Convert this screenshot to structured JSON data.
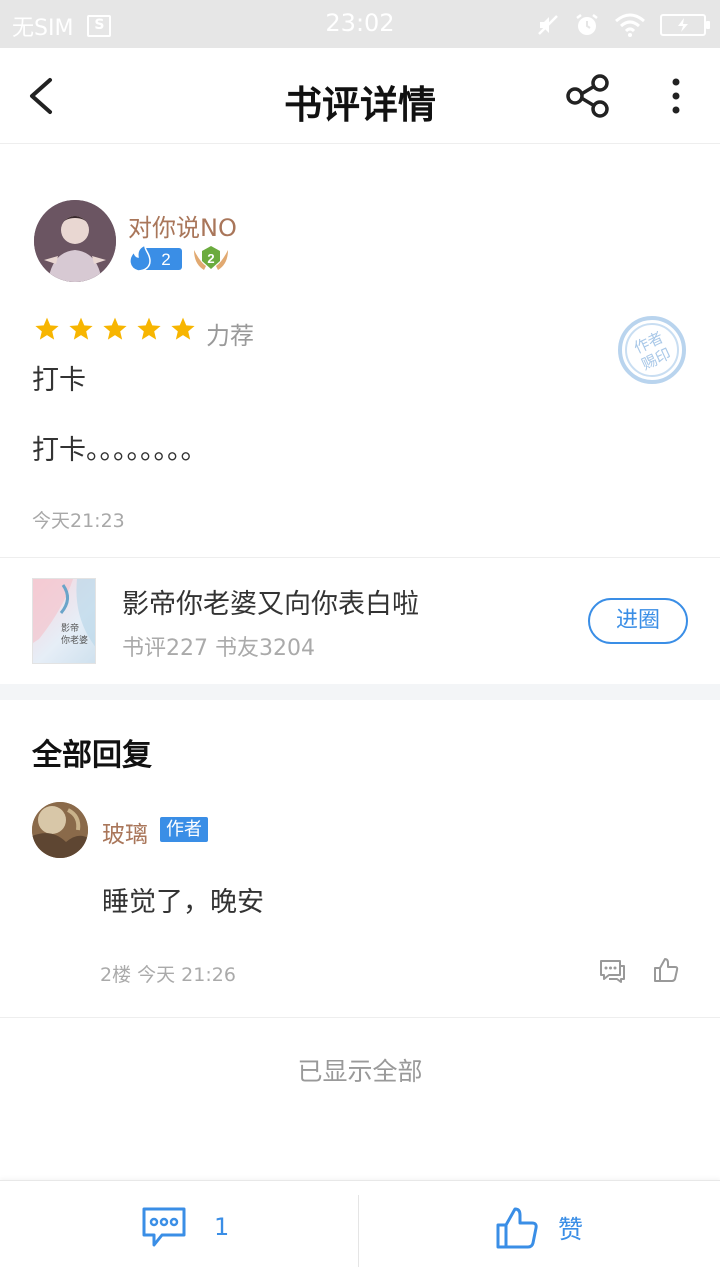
{
  "status_bar": {
    "carrier": "无SIM",
    "sim_icon_label": "S",
    "time": "23:02"
  },
  "header": {
    "title": "书评详情"
  },
  "review": {
    "user": {
      "name": "对你说NO",
      "fire_level": "2",
      "rank_level": "2"
    },
    "rating": {
      "stars": 5,
      "text": "力荐"
    },
    "stamp_text": "作者 赐印",
    "title": "打卡",
    "body": "打卡。。。。。。。。",
    "time": "今天21:23"
  },
  "book": {
    "title": "影帝你老婆又向你表白啦",
    "stats": "书评227 书友3204",
    "join_label": "进圈"
  },
  "replies": {
    "heading": "全部回复",
    "items": [
      {
        "name": "玻璃",
        "tag": "作者",
        "content": "睡觉了，晚安",
        "meta": "2楼 今天 21:26"
      }
    ],
    "footer": "已显示全部"
  },
  "bottom_bar": {
    "comment_count": "1",
    "like_label": "赞"
  },
  "colors": {
    "accent": "#3a8ee6",
    "username": "#a9765a",
    "star": "#f7b500"
  }
}
